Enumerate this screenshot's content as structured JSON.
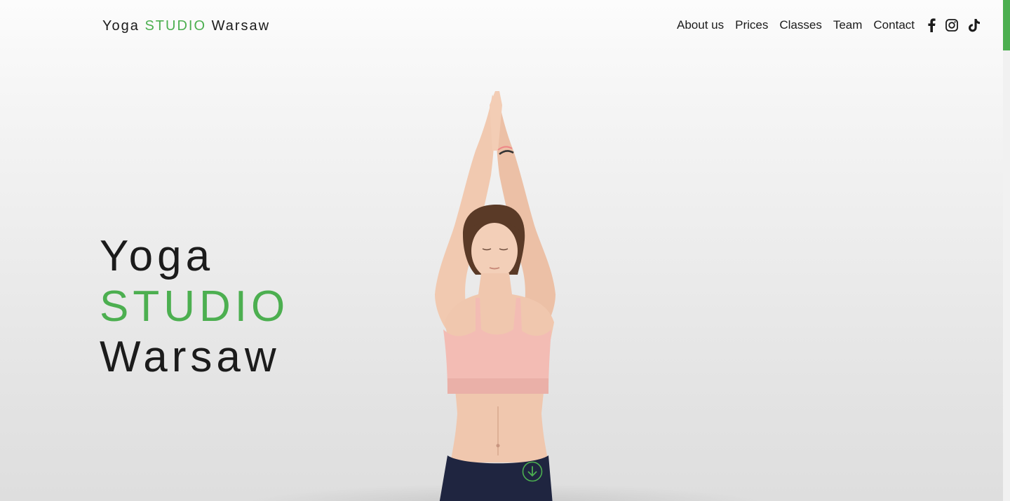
{
  "brand": {
    "part1": "Yoga",
    "part2": "STUDIO",
    "part3": "Warsaw"
  },
  "nav": {
    "items": [
      "About us",
      "Prices",
      "Classes",
      "Team",
      "Contact"
    ]
  },
  "social": [
    "facebook-icon",
    "instagram-icon",
    "tiktok-icon"
  ],
  "hero": {
    "line1": "Yoga",
    "line2": "STUDIO",
    "line3": "Warsaw"
  },
  "colors": {
    "accent": "#4caf50",
    "text": "#1b1b1b"
  }
}
